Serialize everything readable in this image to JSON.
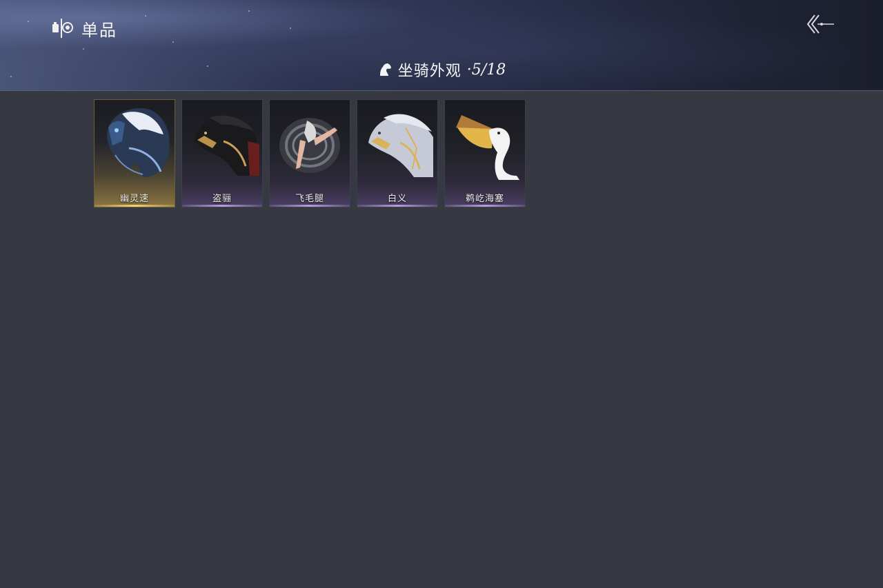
{
  "header": {
    "brand_label": "单品",
    "brand_icon": "mirror-emblem-icon",
    "back_icon": "double-chevron-back-icon"
  },
  "section": {
    "icon": "horse-head-icon",
    "title": "坐骑外观",
    "count": "·5/18"
  },
  "items": [
    {
      "name": "幽灵速",
      "rarity": "gold",
      "icon": "ghost-horse-icon"
    },
    {
      "name": "盗骊",
      "rarity": "purple",
      "icon": "dark-horse-icon"
    },
    {
      "name": "飞毛腿",
      "rarity": "purple",
      "icon": "flying-legs-icon"
    },
    {
      "name": "白义",
      "rarity": "purple",
      "icon": "white-horse-icon"
    },
    {
      "name": "鹈屹海塞",
      "rarity": "purple",
      "icon": "pelican-icon"
    }
  ],
  "colors": {
    "background": "#363941",
    "gold_accent": "#d9b86a",
    "purple_accent": "#b7a6dc"
  }
}
